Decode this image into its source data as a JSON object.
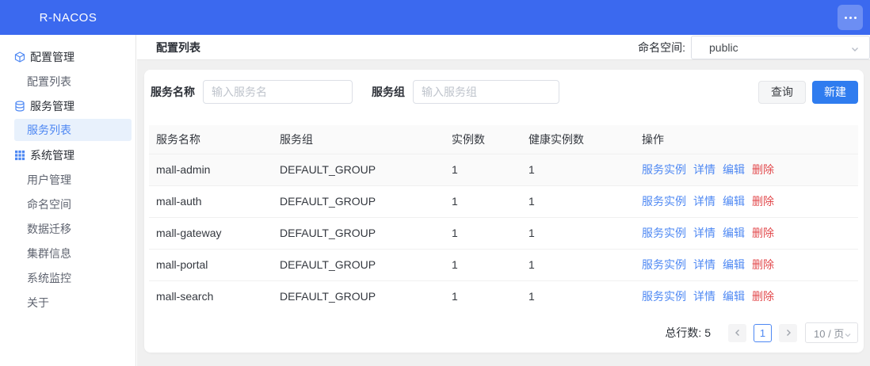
{
  "app": {
    "title": "R-NACOS"
  },
  "header": {
    "menu_icon": "ellipsis-icon"
  },
  "sidebar": {
    "items": [
      {
        "label": "配置管理",
        "type": "group",
        "icon": "cube-icon"
      },
      {
        "label": "配置列表",
        "type": "sub"
      },
      {
        "label": "服务管理",
        "type": "group",
        "icon": "database-icon"
      },
      {
        "label": "服务列表",
        "type": "sub",
        "active": true
      },
      {
        "label": "系统管理",
        "type": "group",
        "icon": "grid-icon"
      },
      {
        "label": "用户管理",
        "type": "sub"
      },
      {
        "label": "命名空间",
        "type": "sub"
      },
      {
        "label": "数据迁移",
        "type": "sub"
      },
      {
        "label": "集群信息",
        "type": "sub"
      },
      {
        "label": "系统监控",
        "type": "sub"
      },
      {
        "label": "关于",
        "type": "sub"
      }
    ]
  },
  "topbar": {
    "page_title": "配置列表",
    "namespace_label": "命名空间:",
    "namespace_value": "public",
    "namespace_dropdown_icon": "chevron-down-icon"
  },
  "toolbar": {
    "service_name_label": "服务名称",
    "service_name_placeholder": "输入服务名",
    "service_name_value": "",
    "service_group_label": "服务组",
    "service_group_placeholder": "输入服务组",
    "service_group_value": "",
    "query_label": "查询",
    "create_label": "新建"
  },
  "table": {
    "columns": [
      "服务名称",
      "服务组",
      "实例数",
      "健康实例数",
      "操作"
    ],
    "row_actions": {
      "instances": "服务实例",
      "detail": "详情",
      "edit": "编辑",
      "delete": "删除"
    },
    "rows": [
      {
        "name": "mall-admin",
        "group": "DEFAULT_GROUP",
        "instances": "1",
        "healthy": "1"
      },
      {
        "name": "mall-auth",
        "group": "DEFAULT_GROUP",
        "instances": "1",
        "healthy": "1"
      },
      {
        "name": "mall-gateway",
        "group": "DEFAULT_GROUP",
        "instances": "1",
        "healthy": "1"
      },
      {
        "name": "mall-portal",
        "group": "DEFAULT_GROUP",
        "instances": "1",
        "healthy": "1"
      },
      {
        "name": "mall-search",
        "group": "DEFAULT_GROUP",
        "instances": "1",
        "healthy": "1"
      }
    ]
  },
  "pagination": {
    "total_label": "总行数:",
    "total_value": "5",
    "prev_icon": "chevron-left-icon",
    "current_page": "1",
    "next_icon": "chevron-right-icon",
    "page_size": "10 / 页",
    "page_size_dropdown_icon": "chevron-down-icon"
  },
  "colors": {
    "header_bg": "#3B69EF",
    "primary_button": "#2F7CEF",
    "link_blue": "#4E88F3",
    "danger_red": "#E2494C",
    "active_item_bg": "#E8F1FC",
    "main_bg": "#F0F0F0",
    "table_header_bg": "#FAFAFA"
  }
}
